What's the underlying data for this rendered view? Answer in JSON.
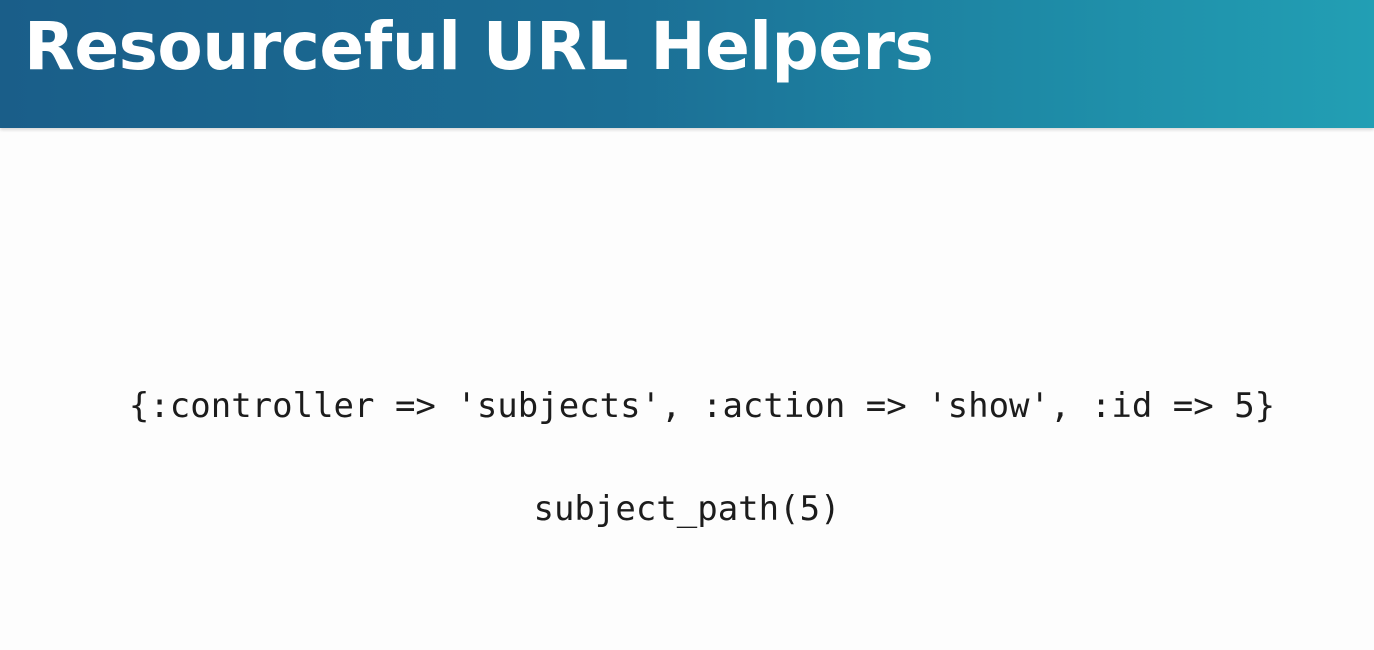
{
  "slide": {
    "title": "Resourceful URL Helpers",
    "code_hash": "{:controller => 'subjects', :action => 'show', :id => 5}",
    "code_helper": "subject_path(5)"
  },
  "colors": {
    "header_gradient_start": "#1a5e89",
    "header_gradient_end": "#229fb4",
    "title_text": "#ffffff",
    "code_text": "#1c1c1c",
    "background": "#fdfdfd"
  }
}
